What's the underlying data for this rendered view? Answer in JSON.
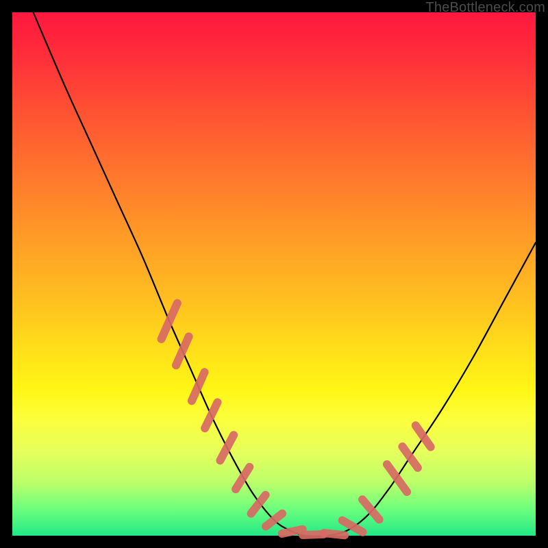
{
  "watermark": "TheBottleneck.com",
  "chart_data": {
    "type": "line",
    "title": "",
    "xlabel": "",
    "ylabel": "",
    "xlim": [
      0,
      100
    ],
    "ylim": [
      0,
      100
    ],
    "series": [
      {
        "name": "curve",
        "x": [
          4,
          10,
          15,
          20,
          25,
          30,
          34,
          38,
          42,
          46,
          50,
          53,
          56,
          60,
          64,
          68,
          72,
          76,
          82,
          88,
          94,
          100
        ],
        "values": [
          100,
          86,
          75,
          64,
          53,
          41,
          32,
          23,
          15,
          8,
          3,
          1,
          0,
          0,
          1,
          4,
          9,
          15,
          24,
          34,
          45,
          56
        ]
      }
    ],
    "markers": {
      "name": "highlight-dashes",
      "color": "#d86a64",
      "segments": [
        {
          "x": 30.0,
          "y": 41.0,
          "angle": 66,
          "len": 7.5
        },
        {
          "x": 32.5,
          "y": 35.3,
          "angle": 66,
          "len": 6.0
        },
        {
          "x": 35.5,
          "y": 28.5,
          "angle": 66,
          "len": 6.0
        },
        {
          "x": 38.0,
          "y": 23.0,
          "angle": 64,
          "len": 5.5
        },
        {
          "x": 41.0,
          "y": 16.8,
          "angle": 62,
          "len": 5.5
        },
        {
          "x": 44.0,
          "y": 11.0,
          "angle": 58,
          "len": 5.0
        },
        {
          "x": 47.0,
          "y": 6.0,
          "angle": 52,
          "len": 4.5
        },
        {
          "x": 50.0,
          "y": 3.0,
          "angle": 38,
          "len": 4.0
        },
        {
          "x": 53.5,
          "y": 0.8,
          "angle": 12,
          "len": 4.0
        },
        {
          "x": 57.5,
          "y": 0.2,
          "angle": 2,
          "len": 4.0
        },
        {
          "x": 61.5,
          "y": 0.3,
          "angle": -6,
          "len": 4.0
        },
        {
          "x": 65.0,
          "y": 1.8,
          "angle": -30,
          "len": 4.5
        },
        {
          "x": 68.5,
          "y": 5.0,
          "angle": -50,
          "len": 5.0
        },
        {
          "x": 73.5,
          "y": 11.0,
          "angle": -54,
          "len": 6.5
        },
        {
          "x": 76.0,
          "y": 15.0,
          "angle": -54,
          "len": 5.0
        },
        {
          "x": 78.5,
          "y": 19.0,
          "angle": -55,
          "len": 5.0
        }
      ]
    }
  }
}
